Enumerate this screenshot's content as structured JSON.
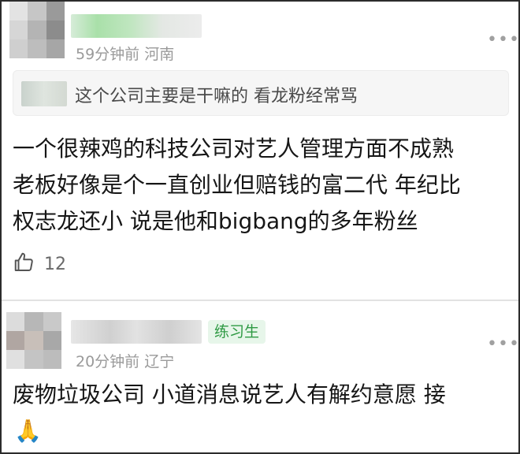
{
  "comments": [
    {
      "time": "59分钟前",
      "location": "河南",
      "quote": "这个公司主要是干嘛的 看龙粉经常骂",
      "body_lines": [
        "一个很辣鸡的科技公司对艺人管理方面不成熟",
        "老板好像是个一直创业但赔钱的富二代 年纪比",
        "权志龙还小 说是他和bigbang的多年粉丝"
      ],
      "likes": "12"
    },
    {
      "badge": "练习生",
      "time": "20分钟前",
      "location": "辽宁",
      "body_lines": [
        "废物垃圾公司 小道消息说艺人有解约意愿 接"
      ],
      "emoji": "🙏"
    }
  ],
  "icons": {
    "more": "more-icon",
    "like": "thumbs-up-icon",
    "pray": "pray-emoji"
  },
  "colors": {
    "meta_text": "#9a9a9a",
    "badge_bg": "#e7f6ea",
    "badge_text": "#2f9a44",
    "quote_bg": "#f6f6f6",
    "border": "#2b2b2b"
  }
}
